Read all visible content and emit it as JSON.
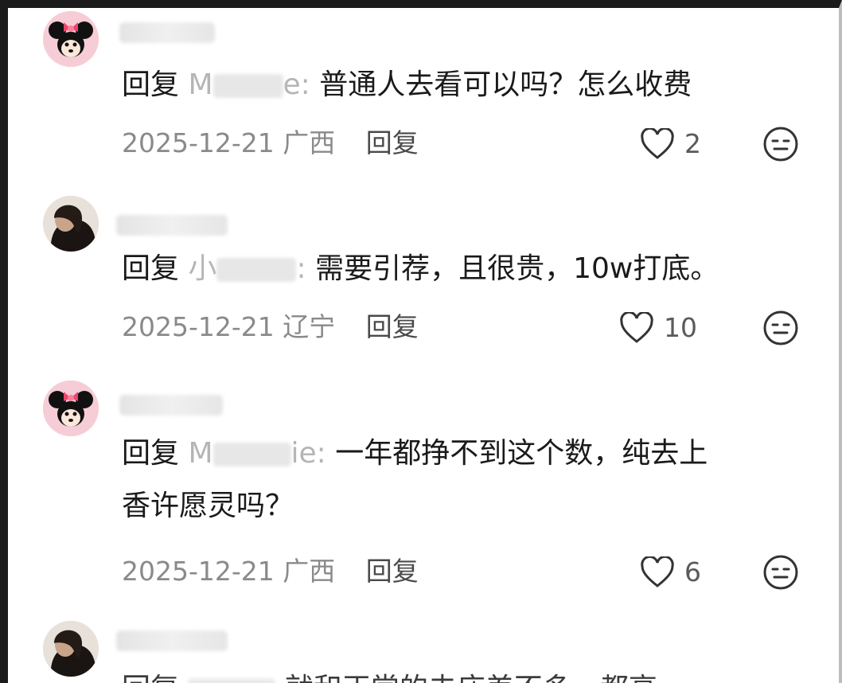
{
  "comments": [
    {
      "avatar": "minnie-mouse-avatar",
      "reply_prefix": "回复",
      "mention_visible_start": "M",
      "mention_visible_end": "e:",
      "text": "普通人去看可以吗？怎么收费",
      "text_line2": "",
      "date": "2025-12-21",
      "location": "广西",
      "reply_label": "回复",
      "likes": "2"
    },
    {
      "avatar": "portrait-avatar",
      "reply_prefix": "回复",
      "mention_visible_start": "小",
      "mention_visible_end": ":",
      "text": "需要引荐，且很贵，10w打底。",
      "text_line2": "",
      "date": "2025-12-21",
      "location": "辽宁",
      "reply_label": "回复",
      "likes": "10"
    },
    {
      "avatar": "minnie-mouse-avatar",
      "reply_prefix": "回复",
      "mention_visible_start": "M",
      "mention_visible_end": "ie:",
      "text": "一年都挣不到这个数，纯去上",
      "text_line2": "香许愿灵吗？",
      "date": "2025-12-21",
      "location": "广西",
      "reply_label": "回复",
      "likes": "6"
    },
    {
      "avatar": "portrait-avatar",
      "reply_prefix": "回复",
      "mention_visible_start": "",
      "mention_visible_end": "",
      "text": "就和正常的去庙差不多，都高",
      "text_line2": "",
      "date": "",
      "location": "",
      "reply_label": "",
      "likes": ""
    }
  ],
  "colors": {
    "text": "#1a1a1a",
    "meta": "#8a8a8a",
    "avatar_pink": "#f3c6d0"
  },
  "icons": [
    "heart-icon",
    "emoji-icon"
  ]
}
